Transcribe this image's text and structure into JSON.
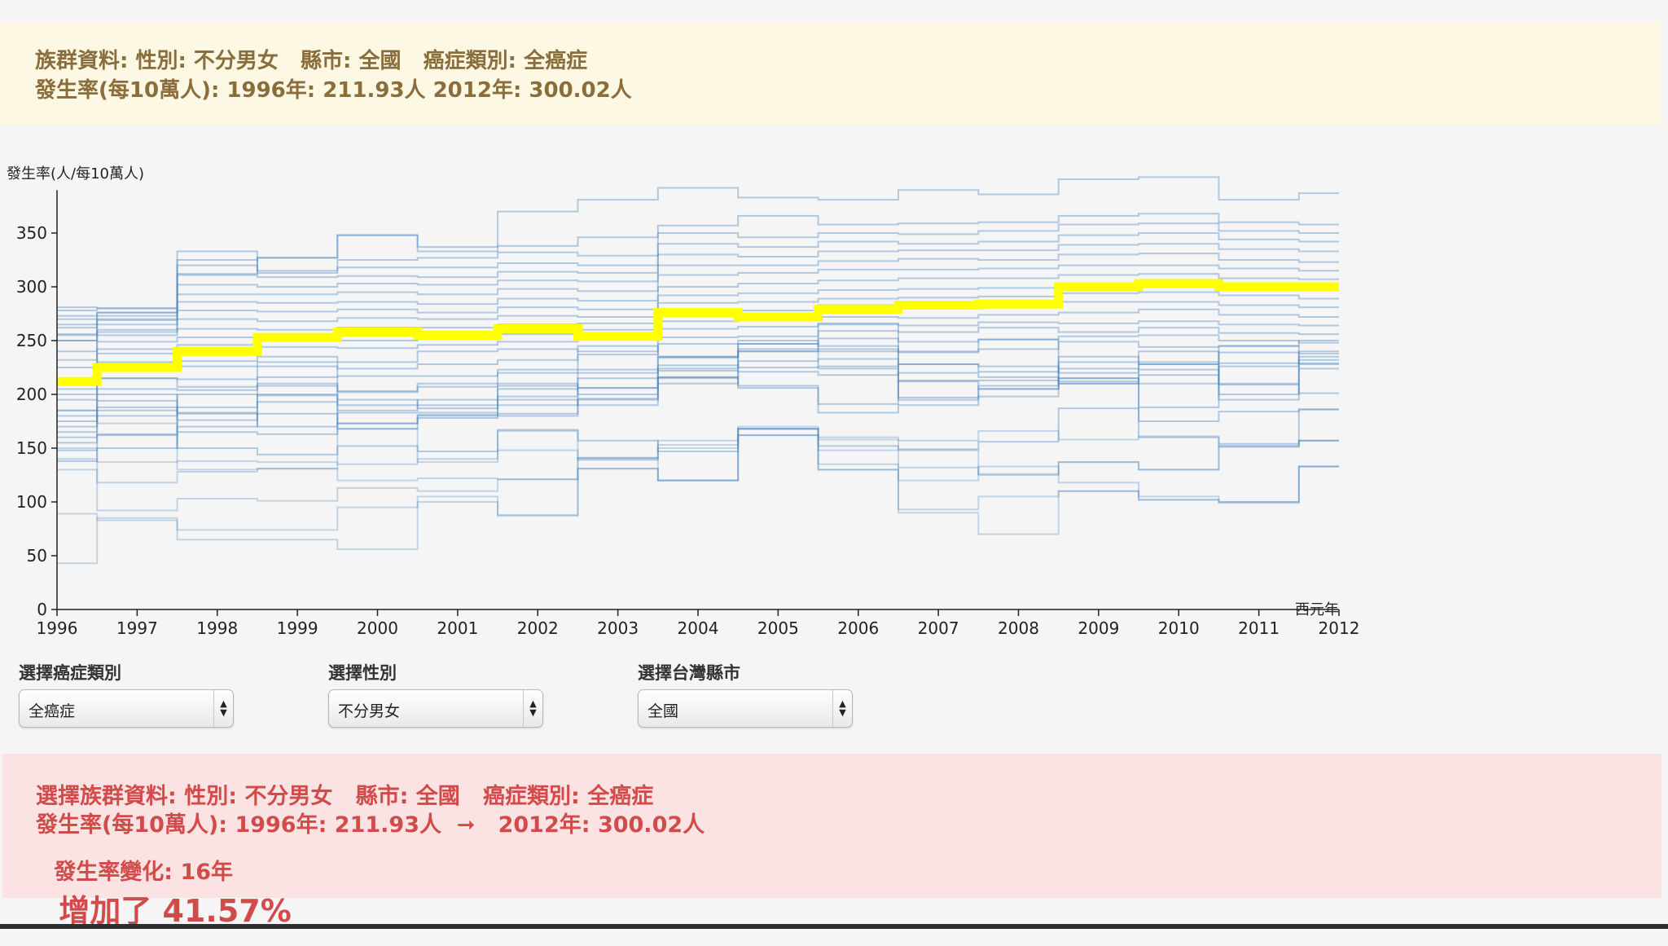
{
  "top_info": {
    "line1": "族群資料: 性別: 不分男女   縣市: 全國   癌症類別: 全癌症",
    "line2": "發生率(每10萬人): 1996年: 211.93人 2012年: 300.02人"
  },
  "chart_data": {
    "type": "line",
    "ylabel": "發生率(人/每10萬人)",
    "xlabel": "西元年",
    "x": [
      1996,
      1997,
      1998,
      1999,
      2000,
      2001,
      2002,
      2003,
      2004,
      2005,
      2006,
      2007,
      2008,
      2009,
      2010,
      2011,
      2012
    ],
    "ylim": [
      0,
      400
    ],
    "yticks": [
      0,
      50,
      100,
      150,
      200,
      250,
      300,
      350
    ],
    "highlight_color": "#ffff00",
    "background_series_color": "#4a86c0",
    "series": [
      {
        "values": [
          211.93,
          225,
          240,
          253,
          258,
          255,
          261,
          254,
          276,
          272,
          279,
          283,
          284,
          300,
          303,
          300,
          300.02
        ]
      }
    ],
    "background_series": [
      [
        43,
        85,
        65,
        65,
        56,
        105,
        87,
        131,
        120,
        168,
        130,
        90,
        70,
        110,
        102,
        100,
        133
      ],
      [
        89,
        83,
        74,
        74,
        95,
        100,
        88,
        131,
        120,
        168,
        130,
        93,
        105,
        110,
        102,
        100,
        133
      ],
      [
        130,
        92,
        103,
        101,
        113,
        110,
        121,
        141,
        120,
        168,
        135,
        120,
        133,
        118,
        105,
        99,
        133
      ],
      [
        140,
        118,
        128,
        131,
        120,
        122,
        121,
        141,
        153,
        168,
        148,
        132,
        125,
        137,
        130,
        152,
        157
      ],
      [
        150,
        137,
        138,
        137,
        135,
        140,
        148,
        139,
        157,
        170,
        158,
        148,
        126,
        137,
        130,
        152,
        157
      ],
      [
        185,
        173,
        130,
        131,
        168,
        137,
        166,
        140,
        150,
        162,
        160,
        157,
        166,
        158,
        161,
        151,
        157
      ],
      [
        160,
        163,
        150,
        144,
        152,
        147,
        167,
        157,
        147,
        162,
        152,
        149,
        156,
        187,
        160,
        154,
        186
      ],
      [
        170,
        185,
        165,
        163,
        173,
        181,
        180,
        196,
        216,
        208,
        183,
        190,
        205,
        215,
        175,
        184,
        186
      ],
      [
        180,
        194,
        183,
        170,
        183,
        183,
        190,
        206,
        216,
        206,
        191,
        213,
        213,
        230,
        228,
        209,
        201
      ],
      [
        195,
        205,
        204,
        208,
        203,
        207,
        210,
        206,
        224,
        231,
        233,
        228,
        221,
        224,
        228,
        239,
        229
      ],
      [
        205,
        215,
        214,
        216,
        217,
        217,
        220,
        223,
        234,
        240,
        240,
        239,
        242,
        249,
        244,
        245,
        238
      ],
      [
        215,
        230,
        226,
        226,
        224,
        228,
        232,
        237,
        247,
        247,
        252,
        249,
        251,
        254,
        255,
        250,
        248
      ],
      [
        225,
        238,
        231,
        235,
        230,
        240,
        242,
        240,
        253,
        254,
        259,
        258,
        262,
        258,
        262,
        257,
        256
      ],
      [
        232,
        242,
        246,
        244,
        243,
        246,
        249,
        252,
        261,
        263,
        266,
        264,
        267,
        266,
        268,
        265,
        264
      ],
      [
        240,
        249,
        253,
        251,
        250,
        252,
        256,
        260,
        268,
        269,
        272,
        271,
        274,
        276,
        279,
        274,
        272
      ],
      [
        250,
        255,
        261,
        260,
        262,
        262,
        265,
        266,
        276,
        278,
        283,
        280,
        283,
        286,
        286,
        283,
        281
      ],
      [
        256,
        260,
        270,
        268,
        271,
        270,
        273,
        272,
        285,
        286,
        289,
        290,
        291,
        294,
        295,
        292,
        289
      ],
      [
        265,
        265,
        278,
        277,
        279,
        276,
        281,
        279,
        292,
        294,
        297,
        298,
        299,
        302,
        303,
        300,
        298
      ],
      [
        270,
        273,
        286,
        285,
        286,
        284,
        289,
        287,
        300,
        303,
        306,
        308,
        308,
        311,
        312,
        308,
        307
      ],
      [
        278,
        280,
        293,
        293,
        295,
        293,
        298,
        296,
        311,
        313,
        316,
        316,
        317,
        320,
        320,
        317,
        315
      ],
      [
        281,
        280,
        302,
        300,
        303,
        302,
        306,
        305,
        320,
        320,
        324,
        326,
        325,
        330,
        331,
        325,
        323
      ],
      [
        250,
        258,
        311,
        309,
        310,
        309,
        314,
        313,
        330,
        328,
        333,
        334,
        334,
        339,
        340,
        335,
        333
      ],
      [
        262,
        270,
        320,
        313,
        318,
        318,
        322,
        320,
        340,
        337,
        342,
        340,
        342,
        348,
        350,
        344,
        342
      ],
      [
        273,
        276,
        333,
        315,
        325,
        327,
        332,
        329,
        350,
        346,
        350,
        349,
        352,
        358,
        359,
        352,
        350
      ],
      [
        255,
        276,
        325,
        327,
        348,
        333,
        338,
        346,
        357,
        366,
        358,
        359,
        360,
        366,
        368,
        360,
        358
      ],
      [
        200,
        269,
        312,
        327,
        348,
        337,
        370,
        381,
        392,
        383,
        381,
        390,
        386,
        400,
        402,
        381,
        387
      ],
      [
        185,
        215,
        207,
        230,
        202,
        210,
        223,
        245,
        235,
        242,
        242,
        240,
        251,
        220,
        240,
        210,
        232
      ],
      [
        175,
        200,
        182,
        210,
        190,
        195,
        205,
        220,
        227,
        225,
        226,
        228,
        226,
        212,
        223,
        200,
        228
      ],
      [
        165,
        188,
        176,
        193,
        185,
        190,
        198,
        215,
        222,
        221,
        218,
        220,
        216,
        210,
        218,
        195,
        224
      ],
      [
        155,
        180,
        200,
        199,
        195,
        187,
        208,
        200,
        210,
        240,
        265,
        212,
        205,
        210,
        188,
        226,
        235
      ],
      [
        148,
        162,
        188,
        200,
        173,
        180,
        195,
        190,
        215,
        250,
        224,
        195,
        198,
        215,
        210,
        229,
        240
      ],
      [
        138,
        150,
        170,
        182,
        168,
        178,
        182,
        195,
        235,
        247,
        245,
        197,
        208,
        235,
        230,
        245,
        250
      ]
    ]
  },
  "controls": {
    "cancer": {
      "label": "選擇癌症類別",
      "value": "全癌症"
    },
    "gender": {
      "label": "選擇性別",
      "value": "不分男女"
    },
    "county": {
      "label": "選擇台灣縣市",
      "value": "全國"
    }
  },
  "bottom_info": {
    "line1": "選擇族群資料: 性別: 不分男女   縣市: 全國   癌症類別: 全癌症",
    "line2": "發生率(每10萬人): 1996年: 211.93人  ➞   2012年: 300.02人",
    "line3_prefix": "發生率變化: 16年",
    "line3_change": "增加了 41.57%"
  }
}
